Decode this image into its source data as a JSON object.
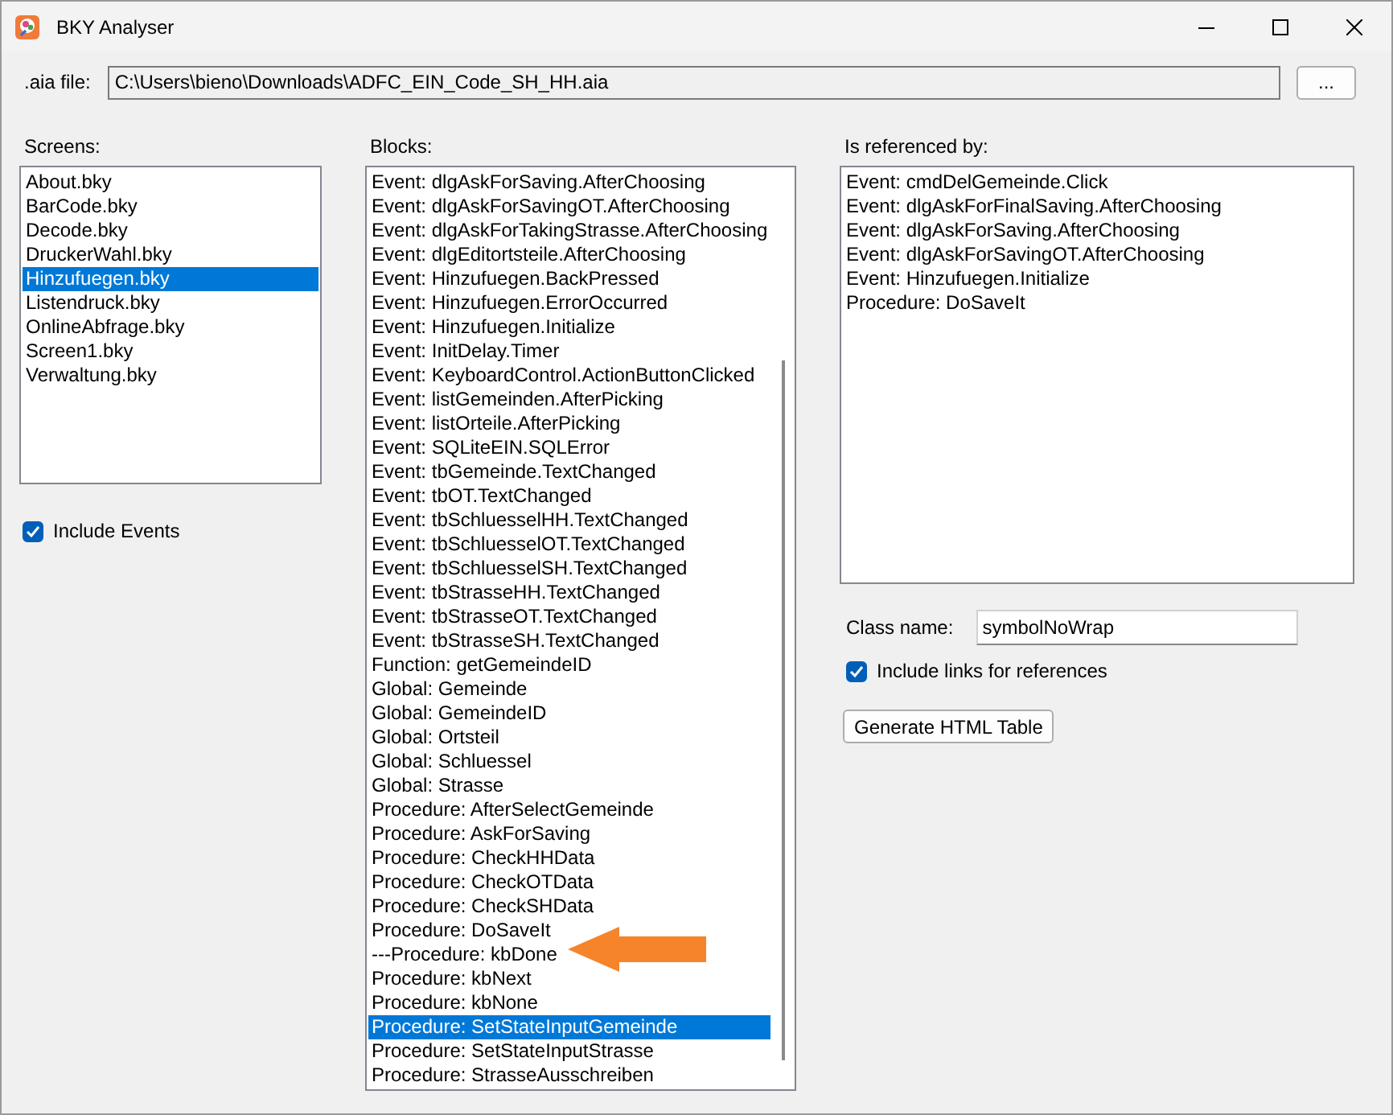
{
  "window": {
    "title": "BKY Analyser"
  },
  "aia_file": {
    "label": ".aia file:",
    "value": "C:\\Users\\bieno\\Downloads\\ADFC_EIN_Code_SH_HH.aia",
    "browse_button": "..."
  },
  "screens": {
    "label": "Screens:",
    "items": [
      {
        "label": "About.bky",
        "selected": false
      },
      {
        "label": "BarCode.bky",
        "selected": false
      },
      {
        "label": "Decode.bky",
        "selected": false
      },
      {
        "label": "DruckerWahl.bky",
        "selected": false
      },
      {
        "label": "Hinzufuegen.bky",
        "selected": true
      },
      {
        "label": "Listendruck.bky",
        "selected": false
      },
      {
        "label": "OnlineAbfrage.bky",
        "selected": false
      },
      {
        "label": "Screen1.bky",
        "selected": false
      },
      {
        "label": "Verwaltung.bky",
        "selected": false
      }
    ],
    "include_events": {
      "label": "Include Events",
      "checked": true
    }
  },
  "blocks": {
    "label": "Blocks:",
    "items": [
      {
        "label": "Event: dlgAskForSaving.AfterChoosing",
        "selected": false
      },
      {
        "label": "Event: dlgAskForSavingOT.AfterChoosing",
        "selected": false
      },
      {
        "label": "Event: dlgAskForTakingStrasse.AfterChoosing",
        "selected": false
      },
      {
        "label": "Event: dlgEditortsteile.AfterChoosing",
        "selected": false
      },
      {
        "label": "Event: Hinzufuegen.BackPressed",
        "selected": false
      },
      {
        "label": "Event: Hinzufuegen.ErrorOccurred",
        "selected": false
      },
      {
        "label": "Event: Hinzufuegen.Initialize",
        "selected": false
      },
      {
        "label": "Event: InitDelay.Timer",
        "selected": false
      },
      {
        "label": "Event: KeyboardControl.ActionButtonClicked",
        "selected": false
      },
      {
        "label": "Event: listGemeinden.AfterPicking",
        "selected": false
      },
      {
        "label": "Event: listOrteile.AfterPicking",
        "selected": false
      },
      {
        "label": "Event: SQLiteEIN.SQLError",
        "selected": false
      },
      {
        "label": "Event: tbGemeinde.TextChanged",
        "selected": false
      },
      {
        "label": "Event: tbOT.TextChanged",
        "selected": false
      },
      {
        "label": "Event: tbSchluesselHH.TextChanged",
        "selected": false
      },
      {
        "label": "Event: tbSchluesselOT.TextChanged",
        "selected": false
      },
      {
        "label": "Event: tbSchluesselSH.TextChanged",
        "selected": false
      },
      {
        "label": "Event: tbStrasseHH.TextChanged",
        "selected": false
      },
      {
        "label": "Event: tbStrasseOT.TextChanged",
        "selected": false
      },
      {
        "label": "Event: tbStrasseSH.TextChanged",
        "selected": false
      },
      {
        "label": "Function: getGemeindeID",
        "selected": false
      },
      {
        "label": "Global: Gemeinde",
        "selected": false
      },
      {
        "label": "Global: GemeindeID",
        "selected": false
      },
      {
        "label": "Global: Ortsteil",
        "selected": false
      },
      {
        "label": "Global: Schluessel",
        "selected": false
      },
      {
        "label": "Global: Strasse",
        "selected": false
      },
      {
        "label": "Procedure: AfterSelectGemeinde",
        "selected": false
      },
      {
        "label": "Procedure: AskForSaving",
        "selected": false
      },
      {
        "label": "Procedure: CheckHHData",
        "selected": false
      },
      {
        "label": "Procedure: CheckOTData",
        "selected": false
      },
      {
        "label": "Procedure: CheckSHData",
        "selected": false
      },
      {
        "label": "Procedure: DoSaveIt",
        "selected": false
      },
      {
        "label": "---Procedure: kbDone",
        "selected": false
      },
      {
        "label": "Procedure: kbNext",
        "selected": false
      },
      {
        "label": "Procedure: kbNone",
        "selected": false
      },
      {
        "label": "Procedure: SetStateInputGemeinde",
        "selected": true
      },
      {
        "label": "Procedure: SetStateInputStrasse",
        "selected": false
      },
      {
        "label": "Procedure: StrasseAusschreiben",
        "selected": false
      }
    ]
  },
  "referenced_by": {
    "label": "Is referenced by:",
    "items": [
      {
        "label": "Event: cmdDelGemeinde.Click",
        "selected": false
      },
      {
        "label": "Event: dlgAskForFinalSaving.AfterChoosing",
        "selected": false
      },
      {
        "label": "Event: dlgAskForSaving.AfterChoosing",
        "selected": false
      },
      {
        "label": "Event: dlgAskForSavingOT.AfterChoosing",
        "selected": false
      },
      {
        "label": "Event: Hinzufuegen.Initialize",
        "selected": false
      },
      {
        "label": "Procedure: DoSaveIt",
        "selected": false
      }
    ],
    "class_name": {
      "label": "Class name:",
      "value": "symbolNoWrap"
    },
    "include_links": {
      "label": "Include links for references",
      "checked": true
    },
    "generate_button": "Generate HTML Table"
  }
}
